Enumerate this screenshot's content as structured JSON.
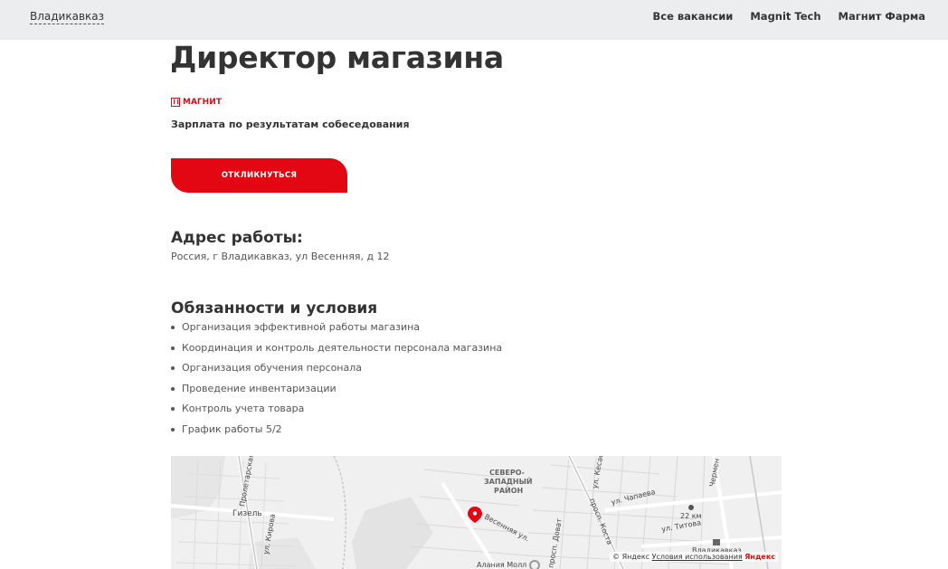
{
  "header": {
    "city": "Владикавказ",
    "nav": [
      "Все вакансии",
      "Magnit Tech",
      "Магнит Фарма"
    ]
  },
  "job": {
    "title": "Директор магазина",
    "brand": "МАГНИТ",
    "salary": "Зарплата по результатам собеседования",
    "apply_label": "ОТКЛИКНУТЬСЯ"
  },
  "address": {
    "heading": "Адрес работы:",
    "value": "Россия, г Владикавказ, ул Весенняя, д 12"
  },
  "duties": {
    "heading": "Обязанности и условия",
    "items": [
      "Организация эффективной работы магазина",
      "Координация и контроль деятельности персонала магазина",
      "Организация обучения персонала",
      "Проведение инвентаризации",
      "Контроль учета товара",
      "График работы 5/2"
    ]
  },
  "map": {
    "labels": {
      "gizel": "Гизель",
      "district1": "СЕВЕРО-",
      "district2": "ЗАПАДНЫЙ",
      "district3": "РАЙОН",
      "street_vesennyaya": "Весенняя ул.",
      "street_chapaeva": "ул. Чапаева",
      "street_titova": "ул. Титова",
      "street_kosta": "просп. Коста",
      "street_kirova": "ул. Кирова",
      "street_proletarskaya": "Пролетарская",
      "street_kesaeva": "ул. Кесае",
      "street_chermen": "Чермен",
      "street_dovatora": "просп. Доват",
      "stop": "22 км",
      "city_part": "Владикавказ",
      "mall": "Алания Молл"
    },
    "credits": {
      "copy": "© Яндекс",
      "terms": "Условия использования",
      "logo": "Яндекс"
    },
    "pin_color": "#e30613"
  },
  "colors": {
    "accent": "#e30613",
    "topbar": "#ebedef"
  }
}
